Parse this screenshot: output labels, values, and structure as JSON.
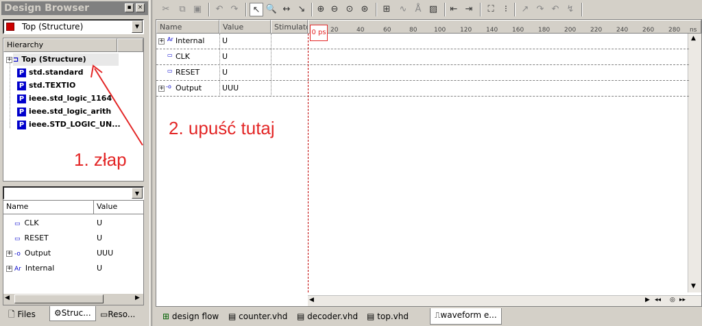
{
  "design_browser": {
    "title": "Design Browser",
    "top_combo": "Top (Structure)",
    "hierarchy_header": "Hierarchy",
    "tree": [
      {
        "label": "Top (Structure)"
      },
      {
        "label": "std.standard"
      },
      {
        "label": "std.TEXTIO"
      },
      {
        "label": "ieee.std_logic_1164"
      },
      {
        "label": "ieee.std_logic_arith"
      },
      {
        "label": "ieee.STD_LOGIC_UN..."
      }
    ],
    "signals_header": {
      "name": "Name",
      "value": "Value"
    },
    "signals": [
      {
        "name": "CLK",
        "value": "U"
      },
      {
        "name": "RESET",
        "value": "U"
      },
      {
        "name": "Output",
        "value": "UUU"
      },
      {
        "name": "Internal",
        "value": "U"
      }
    ],
    "tabs": [
      {
        "label": "Files"
      },
      {
        "label": "Struc..."
      },
      {
        "label": "Reso..."
      }
    ]
  },
  "waveform": {
    "headers": {
      "name": "Name",
      "value": "Value",
      "stimulator": "Stimulator"
    },
    "cursor_time": "0 ps",
    "ticks": [
      "20",
      "40",
      "60",
      "80",
      "100",
      "120",
      "140",
      "160",
      "180",
      "200",
      "220",
      "240",
      "260",
      "280",
      "ns"
    ],
    "signals": [
      {
        "name": "Internal",
        "value": "U"
      },
      {
        "name": "CLK",
        "value": "U"
      },
      {
        "name": "RESET",
        "value": "U"
      },
      {
        "name": "Output",
        "value": "UUU"
      }
    ]
  },
  "annotations": {
    "step1": "1. złap",
    "step2": "2. upuść tutaj",
    "color": "#e32626"
  },
  "doc_tabs": [
    {
      "label": "design flow"
    },
    {
      "label": "counter.vhd"
    },
    {
      "label": "decoder.vhd"
    },
    {
      "label": "top.vhd"
    },
    {
      "label": "waveform e..."
    }
  ],
  "icons": {
    "p_icon": "P",
    "scroll_left": "◀",
    "scroll_right": "▶",
    "dropdown": "▼"
  }
}
